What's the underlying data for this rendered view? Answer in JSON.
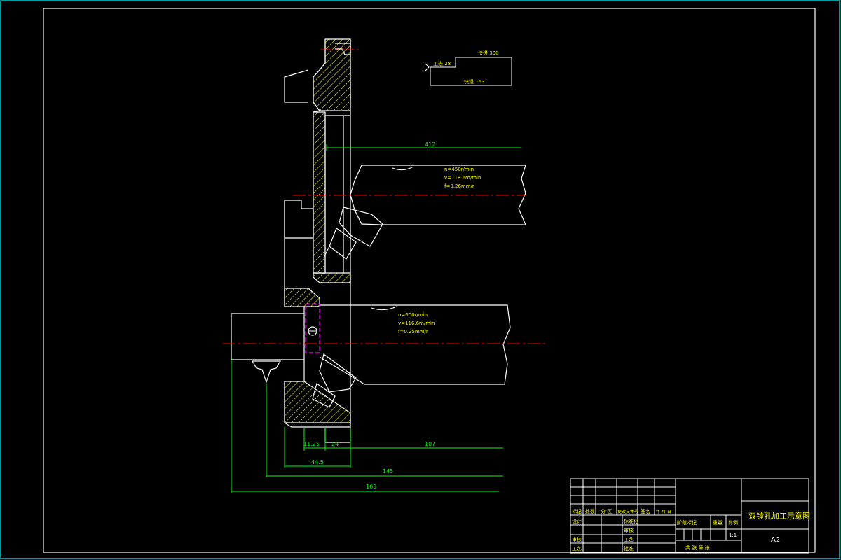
{
  "legend": {
    "feed_label": "工进 28",
    "rapid_forward_label": "快进 300",
    "rapid_return_label": "快退 163"
  },
  "process": {
    "upper": {
      "n": "n=450r/min",
      "v": "v=118.6m/min",
      "f": "f=0.26mm/r"
    },
    "lower": {
      "n": "n=600r/min",
      "v": "v=116.6m/min",
      "f": "f=0.25mm/r"
    }
  },
  "dimensions": {
    "d412": "412",
    "d11_25": "11.25",
    "d24": "24",
    "d107": "107",
    "d44_5": "44.5",
    "d145": "145",
    "d165": "165"
  },
  "title_block": {
    "drawing_title": "双镗孔加工示意图",
    "sheet_size": "A2",
    "scale": "1:1",
    "marks_header": [
      "标记",
      "处数",
      "分 区",
      "更改文件号",
      "签名",
      "年 月 日"
    ],
    "design": "设计",
    "standardization": "标准化",
    "review": "审核",
    "process_eng": "工艺",
    "approve": "批准",
    "stage_mark": "阶段标记",
    "weight": "重量",
    "ratio": "比例",
    "sheet_count": "共  张  第  张"
  },
  "colors": {
    "background": "#000000",
    "outline": "#ffffff",
    "frame": "#00ffff",
    "dimension": "#00ff00",
    "centerline": "#ff0000",
    "hatch": "#ffff00",
    "aux": "#ff00ff"
  }
}
